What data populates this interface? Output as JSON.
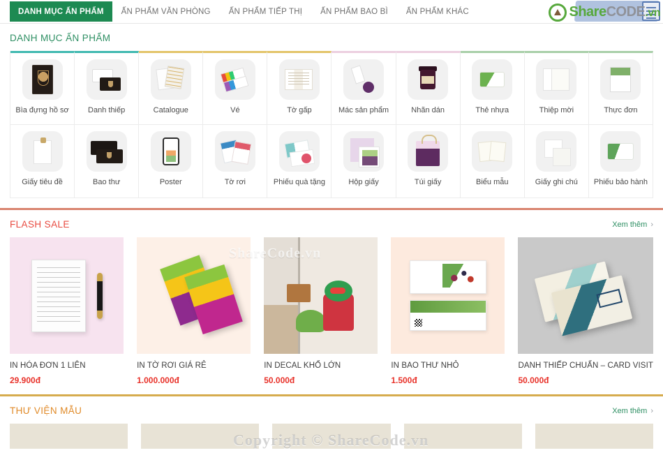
{
  "nav": {
    "items": [
      {
        "label": "DANH MỤC ẤN PHẨM",
        "active": true
      },
      {
        "label": "ẤN PHẨM VĂN PHÒNG",
        "active": false
      },
      {
        "label": "ẤN PHẨM TIẾP THỊ",
        "active": false
      },
      {
        "label": "ẤN PHẨM BAO BÌ",
        "active": false
      },
      {
        "label": "ẤN PHẨM KHÁC",
        "active": false
      }
    ],
    "logo": {
      "share": "Share",
      "code": "CODE",
      "vn": ".vn"
    }
  },
  "categories": {
    "title": "DANH MỤC ẤN PHẨM",
    "accent": "#2e8f63",
    "items": [
      {
        "label": "Bìa đựng hồ sơ",
        "bar": "#3fb8b0"
      },
      {
        "label": "Danh thiếp",
        "bar": "#3fb8b0"
      },
      {
        "label": "Catalogue",
        "bar": "#e3c469"
      },
      {
        "label": "Vé",
        "bar": "#e3c469"
      },
      {
        "label": "Tờ gấp",
        "bar": "#e3c469"
      },
      {
        "label": "Mác sản phẩm",
        "bar": "#eccfe0"
      },
      {
        "label": "Nhãn dán",
        "bar": "#eccfe0"
      },
      {
        "label": "Thẻ nhựa",
        "bar": "#a8cfa8"
      },
      {
        "label": "Thiệp mời",
        "bar": "#a8cfa8"
      },
      {
        "label": "Thực đơn",
        "bar": "#a8cfa8"
      },
      {
        "label": "Giấy tiêu đề",
        "bar": ""
      },
      {
        "label": "Bao thư",
        "bar": ""
      },
      {
        "label": "Poster",
        "bar": ""
      },
      {
        "label": "Tờ rơi",
        "bar": ""
      },
      {
        "label": "Phiếu quà tặng",
        "bar": ""
      },
      {
        "label": "Hộp giấy",
        "bar": ""
      },
      {
        "label": "Túi giấy",
        "bar": ""
      },
      {
        "label": "Biểu mẫu",
        "bar": ""
      },
      {
        "label": "Giấy ghi chú",
        "bar": ""
      },
      {
        "label": "Phiếu bảo hành",
        "bar": ""
      }
    ]
  },
  "flash_sale": {
    "title": "FLASH SALE",
    "accent": "#e8493f",
    "more_label": "Xem thêm",
    "more_chevron": "›",
    "products": [
      {
        "name": "IN HÓA ĐƠN 1 LIÊN",
        "price": "29.900đ",
        "bg": "#f7e3ef"
      },
      {
        "name": "IN TỜ RƠI GIÁ RẺ",
        "price": "1.000.000đ",
        "bg": "#fdf0e7"
      },
      {
        "name": "IN DECAL KHỔ LỚN",
        "price": "50.000đ",
        "bg": "#ded7cc"
      },
      {
        "name": "IN BAO THƯ NHỎ",
        "price": "1.500đ",
        "bg": "#fdeade"
      },
      {
        "name": "DANH THIẾP CHUẨN – CARD VISIT",
        "price": "50.000đ",
        "bg": "#c9c9c9"
      }
    ]
  },
  "library": {
    "title": "THƯ VIỆN MẪU",
    "accent": "#e08a28",
    "more_label": "Xem thêm",
    "more_chevron": "›",
    "cells": 5
  },
  "watermarks": {
    "top": "ShareCode.vn",
    "bottom": "Copyright © ShareCode.vn"
  }
}
